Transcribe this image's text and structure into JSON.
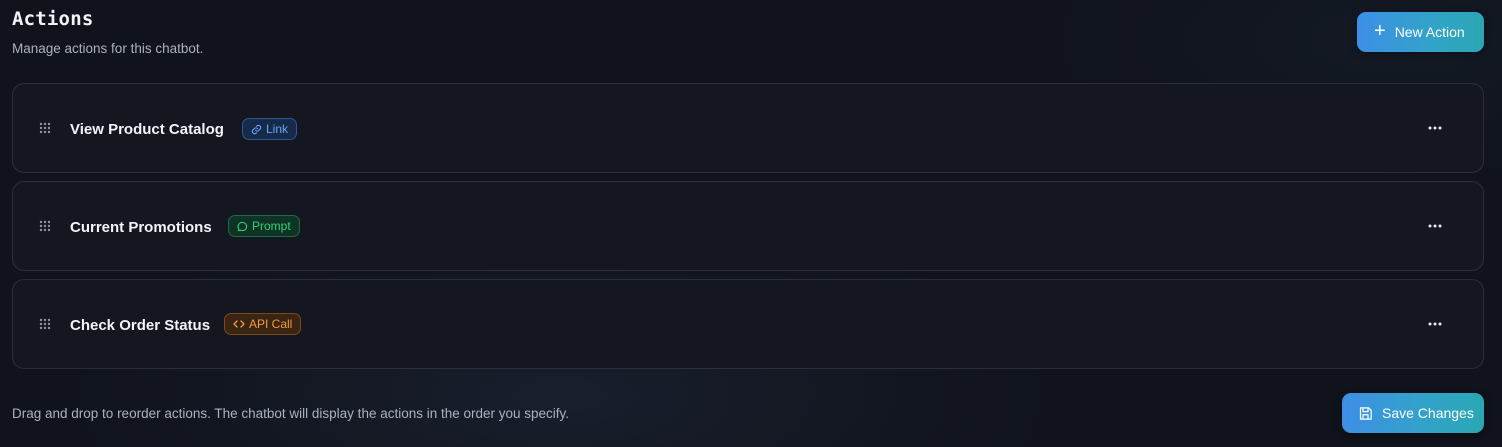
{
  "header": {
    "title": "Actions",
    "subtitle": "Manage actions for this chatbot."
  },
  "toolbar": {
    "new_action_label": "New Action",
    "new_action_icon": "plus-icon",
    "save_label": "Save Changes",
    "save_icon": "save-icon"
  },
  "actions": [
    {
      "name": "View Product Catalog",
      "type": "Link",
      "type_icon": "link-icon",
      "type_color": "#6aa3ff"
    },
    {
      "name": "Current Promotions",
      "type": "Prompt",
      "type_icon": "chat-bubble-icon",
      "type_color": "#2fd27a"
    },
    {
      "name": "Check Order Status",
      "type": "API Call",
      "type_icon": "code-icon",
      "type_color": "#f29a3c"
    }
  ],
  "footer": {
    "note": "Drag and drop to reorder actions. The chatbot will display the actions in the order you specify."
  },
  "colors": {
    "background": "#10131b",
    "card": "#141720",
    "accent_gradient_start": "#3d8fe6",
    "accent_gradient_end": "#2aa7b3"
  }
}
